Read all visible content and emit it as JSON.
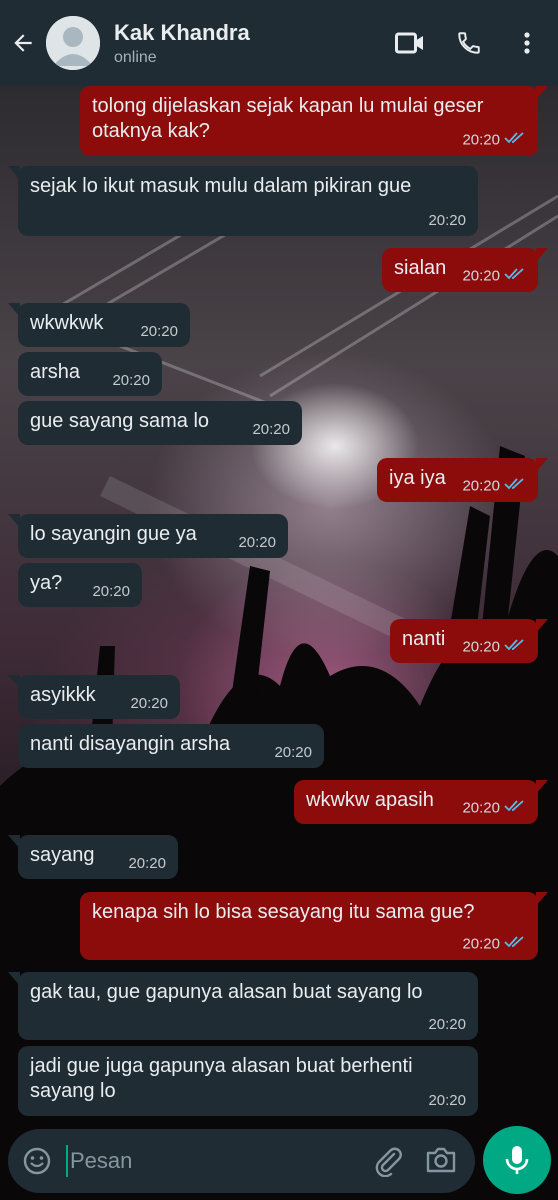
{
  "header": {
    "contact_name": "Kak Khandra",
    "status": "online"
  },
  "messages": [
    {
      "dir": "out",
      "lines": [
        "tolong dijelaskan sejak kapan lu mulai geser",
        "otaknya kak?"
      ],
      "time": "20:20",
      "read": true
    },
    {
      "dir": "in",
      "lines": [
        "sejak lo ikut masuk mulu dalam pikiran gue"
      ],
      "time": "20:20"
    },
    {
      "dir": "out",
      "lines": [
        "sialan"
      ],
      "time": "20:20",
      "read": true
    },
    {
      "dir": "in",
      "lines": [
        "wkwkwk"
      ],
      "time": "20:20"
    },
    {
      "dir": "in",
      "lines": [
        "arsha"
      ],
      "time": "20:20"
    },
    {
      "dir": "in",
      "lines": [
        "gue sayang sama lo"
      ],
      "time": "20:20"
    },
    {
      "dir": "out",
      "lines": [
        "iya iya"
      ],
      "time": "20:20",
      "read": true
    },
    {
      "dir": "in",
      "lines": [
        "lo sayangin gue ya"
      ],
      "time": "20:20"
    },
    {
      "dir": "in",
      "lines": [
        "ya?"
      ],
      "time": "20:20"
    },
    {
      "dir": "out",
      "lines": [
        "nanti"
      ],
      "time": "20:20",
      "read": true
    },
    {
      "dir": "in",
      "lines": [
        "asyikkk"
      ],
      "time": "20:20"
    },
    {
      "dir": "in",
      "lines": [
        "nanti disayangin arsha"
      ],
      "time": "20:20"
    },
    {
      "dir": "out",
      "lines": [
        "wkwkw apasih"
      ],
      "time": "20:20",
      "read": true
    },
    {
      "dir": "in",
      "lines": [
        "sayang"
      ],
      "time": "20:20"
    },
    {
      "dir": "out",
      "lines": [
        "kenapa sih lo bisa sesayang itu sama gue?"
      ],
      "time": "20:20",
      "read": true
    },
    {
      "dir": "in",
      "lines": [
        "gak tau, gue gapunya alasan buat sayang lo"
      ],
      "time": "20:20"
    },
    {
      "dir": "in",
      "lines": [
        "jadi gue juga gapunya alasan buat berhenti",
        "sayang lo"
      ],
      "time": "20:20"
    }
  ],
  "composer": {
    "placeholder": "Pesan"
  },
  "colors": {
    "header_bg": "#1f2c34",
    "incoming_bubble": "#1f2c34",
    "outgoing_bubble": "#8c0c0c",
    "read_ticks": "#53bdeb",
    "mic_button": "#00a884"
  },
  "icons": [
    "back-arrow-icon",
    "avatar-placeholder-icon",
    "video-call-icon",
    "voice-call-icon",
    "more-vert-icon",
    "emoji-icon",
    "attach-icon",
    "camera-icon",
    "mic-icon",
    "double-check-icon"
  ]
}
